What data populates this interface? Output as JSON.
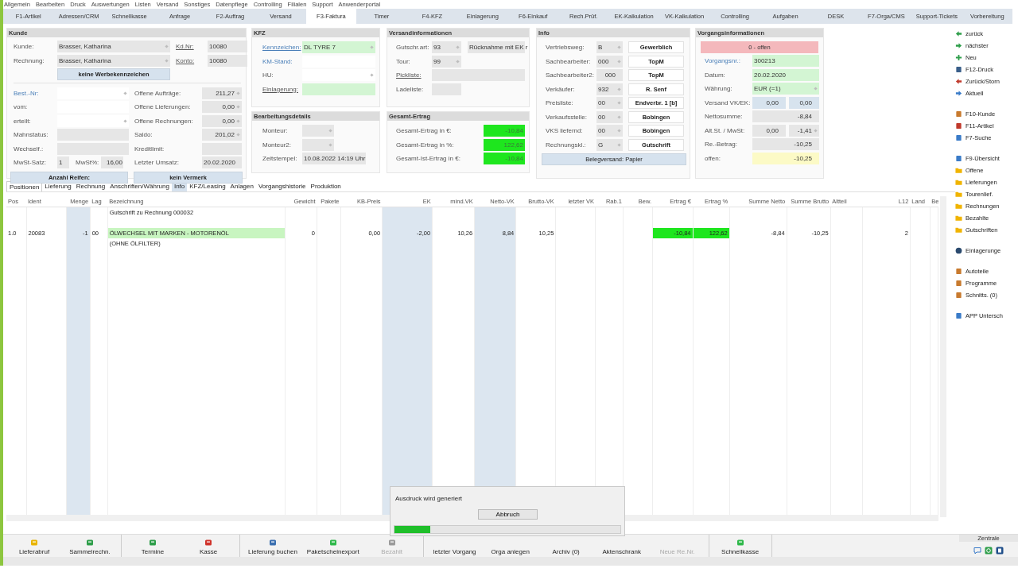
{
  "menu": [
    "Allgemein",
    "Bearbeiten",
    "Druck",
    "Auswertungen",
    "Listen",
    "Versand",
    "Sonstiges",
    "Datenpflege",
    "Controlling",
    "Filialen",
    "Support",
    "Anwenderportal"
  ],
  "tabs": [
    {
      "label": "F1-Artikel",
      "selected": false
    },
    {
      "label": "Adressen/CRM",
      "selected": false
    },
    {
      "label": "Schnellkasse",
      "selected": false
    },
    {
      "label": "Anfrage",
      "selected": false
    },
    {
      "label": "F2-Auftrag",
      "selected": false
    },
    {
      "label": "Versand",
      "selected": false
    },
    {
      "label": "F3-Faktura",
      "selected": true
    },
    {
      "label": "Timer",
      "selected": false
    },
    {
      "label": "F4-KFZ",
      "selected": false
    },
    {
      "label": "Einlagerung",
      "selected": false
    },
    {
      "label": "F6-Einkauf",
      "selected": false
    },
    {
      "label": "Rech.Prüf.",
      "selected": false
    },
    {
      "label": "EK-Kalkulation",
      "selected": false
    },
    {
      "label": "VK-Kalkulation",
      "selected": false
    },
    {
      "label": "Controlling",
      "selected": false
    },
    {
      "label": "Aufgaben",
      "selected": false
    },
    {
      "label": "DESK",
      "selected": false
    },
    {
      "label": "F7-Orga/CMS",
      "selected": false
    },
    {
      "label": "Support-Tickets",
      "selected": false
    },
    {
      "label": "Vorbereitung",
      "selected": false
    }
  ],
  "kunde": {
    "title": "Kunde",
    "top": [
      {
        "label": "Kunde:",
        "field": {
          "value": "Brasser, Katharina",
          "color": "#e6e6e6",
          "dropdown": true
        },
        "id_label": "Kd.Nr:",
        "id_field": {
          "value": "10080",
          "color": "#e6e6e6"
        }
      },
      {
        "label": "Rechnung:",
        "field": {
          "value": "Brasser, Katharina",
          "color": "#e6e6e6",
          "dropdown": true
        },
        "id_label": "Konto:",
        "id_field": {
          "value": "10080",
          "color": "#e6e6e6"
        }
      }
    ],
    "button": "keine Werbekennzeichen",
    "left": [
      {
        "label": "Best.-Nr:",
        "link": false,
        "accent": true,
        "fields": [
          {
            "color": "#ffffff",
            "dropdown": true
          }
        ]
      },
      {
        "label": "vom:",
        "link": false,
        "accent": false,
        "fields": [
          {
            "color": "#ffffff"
          }
        ]
      },
      {
        "label": "erteilt:",
        "link": false,
        "accent": false,
        "fields": [
          {
            "color": "#ffffff",
            "dropdown": true
          }
        ]
      },
      {
        "label": "Mahnstatus:",
        "link": false,
        "accent": false,
        "fields": [
          {
            "color": "#e6e6e6"
          }
        ]
      },
      {
        "label": "Wechself.:",
        "link": false,
        "accent": false,
        "fields": [
          {
            "color": "#e6e6e6"
          }
        ]
      }
    ],
    "mwst": {
      "label": "MwSt-Satz:",
      "field": {
        "value": "1",
        "color": "#e6e6e6"
      },
      "label2": "MwSt%:",
      "field2": {
        "value": "16,00",
        "color": "#e6e6e6"
      }
    },
    "right": [
      {
        "label": "Offene Aufträge:",
        "link": false,
        "accent": false,
        "fields": [
          {
            "value": "211,27",
            "color": "#e6e6e6",
            "dropdown": true
          }
        ]
      },
      {
        "label": "Offene Lieferungen:",
        "link": false,
        "accent": false,
        "fields": [
          {
            "value": "0,00",
            "color": "#e6e6e6",
            "dropdown": true
          }
        ]
      },
      {
        "label": "Offene Rechnungen:",
        "link": false,
        "accent": false,
        "fields": [
          {
            "value": "0,00",
            "color": "#e6e6e6",
            "dropdown": true
          }
        ]
      },
      {
        "label": "Saldo:",
        "link": false,
        "accent": false,
        "fields": [
          {
            "value": "201,02",
            "color": "#e6e6e6",
            "dropdown": true
          }
        ]
      },
      {
        "label": "Kreditlimit:",
        "link": false,
        "accent": false,
        "fields": [
          {
            "color": "#e6e6e6"
          }
        ]
      },
      {
        "label": "Letzter Umsatz:",
        "link": false,
        "accent": false,
        "fields": [
          {
            "value": "20.02.2020",
            "color": "#e6e6e6"
          }
        ]
      }
    ],
    "buttons": [
      "Anzahl Reifen:",
      "kein Vermerk"
    ]
  },
  "kfz": {
    "title": "KFZ",
    "rows": [
      {
        "label": "Kennzeichen:",
        "link": true,
        "accent": true,
        "fields": [
          {
            "value": "DL TYRE 7",
            "color": "#d3f5d3",
            "dropdown": true
          }
        ]
      },
      {
        "label": "KM-Stand:",
        "link": false,
        "accent": true,
        "fields": [
          {
            "color": "#ffffff"
          }
        ]
      },
      {
        "label": "HU:",
        "link": false,
        "accent": false,
        "fields": [
          {
            "color": "#ffffff",
            "dropdown": true
          }
        ]
      },
      {
        "label": "Einlagerung:",
        "link": true,
        "accent": false,
        "fields": [
          {
            "color": "#d3f5d3"
          }
        ]
      }
    ]
  },
  "bearbeitung": {
    "title": "Bearbeitungsdetails",
    "rows": [
      {
        "label": "Monteur:",
        "link": false,
        "accent": false,
        "fields": [
          {
            "color": "#e6e6e6",
            "dropdown": true
          }
        ]
      },
      {
        "label": "Monteur2:",
        "link": false,
        "accent": false,
        "fields": [
          {
            "color": "#e6e6e6",
            "dropdown": true
          }
        ]
      },
      {
        "label": "Zeitstempel:",
        "link": false,
        "accent": false,
        "fields": [
          {
            "value": "10.08.2022 14:19 Uhr",
            "color": "#e6e6e6"
          }
        ]
      }
    ]
  },
  "versand": {
    "title": "Versandinformationen",
    "rows": [
      {
        "label": "Gutschr.art:",
        "link": false,
        "accent": false,
        "fields": [
          {
            "value": "93",
            "color": "#e6e6e6",
            "dropdown": true
          },
          {
            "value": "Rücknahme mit EK r",
            "color": "#e6e6e6"
          }
        ]
      },
      {
        "label": "Tour:",
        "link": false,
        "accent": false,
        "fields": [
          {
            "value": "99",
            "color": "#e6e6e6",
            "dropdown": true
          }
        ]
      },
      {
        "label": "Pickliste:",
        "link": true,
        "accent": false,
        "fields": [
          {
            "color": "#e6e6e6"
          }
        ]
      },
      {
        "label": "Ladeliste:",
        "link": false,
        "accent": false,
        "fields": [
          {
            "color": "#e6e6e6"
          }
        ]
      }
    ]
  },
  "ertrag": {
    "title": "Gesamt-Ertrag",
    "rows": [
      {
        "label": "Gesamt-Ertrag in €:",
        "link": false,
        "accent": false,
        "fields": [
          {
            "value": "-10,84",
            "color": "#1ee61e"
          }
        ]
      },
      {
        "label": "Gesamt-Ertrag in %:",
        "link": false,
        "accent": false,
        "fields": [
          {
            "value": "122,62",
            "color": "#1ee61e"
          }
        ]
      },
      {
        "label": "Gesamt-Ist-Ertrag in €:",
        "link": false,
        "accent": false,
        "fields": [
          {
            "value": "-10,84",
            "color": "#1ee61e"
          }
        ]
      }
    ]
  },
  "info": {
    "title": "Info",
    "rows": [
      {
        "label": "Vertriebsweg:",
        "code": {
          "value": "B",
          "color": "#e6e6e6",
          "dropdown": true
        },
        "button": "Gewerblich"
      },
      {
        "label": "Sachbearbeiter:",
        "code": {
          "value": "000",
          "color": "#e6e6e6",
          "dropdown": true
        },
        "button": "TopM"
      },
      {
        "label": "Sachbearbeiter2:",
        "code": {
          "value": "000",
          "color": "#e6e6e6"
        },
        "button": "TopM"
      },
      {
        "label": "Verkäufer:",
        "code": {
          "value": "932",
          "color": "#e6e6e6",
          "dropdown": true
        },
        "button": "R. Senf"
      },
      {
        "label": "Preisliste:",
        "code": {
          "value": "00",
          "color": "#e6e6e6",
          "dropdown": true
        },
        "button": "Endverbr. 1 [b]"
      },
      {
        "label": "Verkaufsstelle:",
        "code": {
          "value": "00",
          "color": "#e6e6e6",
          "dropdown": true
        },
        "button": "Bobingen"
      },
      {
        "label": "VKS liefernd:",
        "code": {
          "value": "00",
          "color": "#e6e6e6",
          "dropdown": true
        },
        "button": "Bobingen"
      },
      {
        "label": "Rechnungskl.:",
        "code": {
          "value": "G",
          "color": "#e6e6e6",
          "dropdown": true
        },
        "button": "Gutschrift"
      }
    ],
    "footer_button": "Belegversand: Papier"
  },
  "vorgang": {
    "title": "Vorgangsinformationen",
    "status": "0 - offen",
    "rows": [
      {
        "label": "Vorgangsnr.:",
        "link": false,
        "accent": true,
        "fields": [
          {
            "value": "300213",
            "color": "#d3f5d3"
          }
        ]
      },
      {
        "label": "Datum:",
        "link": false,
        "accent": false,
        "fields": [
          {
            "value": "20.02.2020",
            "color": "#d3f5d3"
          }
        ]
      },
      {
        "label": "Währung:",
        "link": false,
        "accent": false,
        "fields": [
          {
            "value": "EUR (=1)",
            "color": "#d3f5d3",
            "dropdown": true
          }
        ]
      },
      {
        "label": "Versand VK/EK:",
        "link": false,
        "accent": false,
        "fields": [
          {
            "value": "0,00",
            "color": "#d7e3ee"
          },
          {
            "value": "0,00",
            "color": "#d7e3ee"
          }
        ]
      },
      {
        "label": "Nettosumme:",
        "link": false,
        "accent": false,
        "fields": [
          {
            "value": "-8,84",
            "color": "#e6e6e6"
          }
        ]
      },
      {
        "label": "Alt.St. / MwSt:",
        "link": false,
        "accent": false,
        "fields": [
          {
            "value": "0,00",
            "color": "#e6e6e6"
          },
          {
            "value": "-1,41",
            "color": "#e6e6e6",
            "dropdown": true
          }
        ]
      },
      {
        "label": "Re.-Betrag:",
        "link": false,
        "accent": false,
        "fields": [
          {
            "value": "-10,25",
            "color": "#e6e6e6"
          }
        ]
      },
      {
        "label": "offen:",
        "link": false,
        "accent": false,
        "fields": [
          {
            "value": "-10,25",
            "color": "#fcfac6"
          }
        ]
      }
    ]
  },
  "subtabs": [
    {
      "label": "Positionen",
      "selected": true,
      "highlighted": false
    },
    {
      "label": "Lieferung",
      "selected": false,
      "highlighted": false
    },
    {
      "label": "Rechnung",
      "selected": false,
      "highlighted": false
    },
    {
      "label": "Anschriften/Währung",
      "selected": false,
      "highlighted": false
    },
    {
      "label": "Info",
      "selected": false,
      "highlighted": true
    },
    {
      "label": "KFZ/Leasing",
      "selected": false,
      "highlighted": false
    },
    {
      "label": "Anlagen",
      "selected": false,
      "highlighted": false
    },
    {
      "label": "Vorgangshistorie",
      "selected": false,
      "highlighted": false
    },
    {
      "label": "Produktion",
      "selected": false,
      "highlighted": false
    }
  ],
  "table": {
    "columns": [
      {
        "label": "Pos",
        "shaded": false
      },
      {
        "label": "Ident",
        "shaded": false
      },
      {
        "label": "Menge",
        "shaded": true
      },
      {
        "label": "Lag",
        "shaded": false
      },
      {
        "label": "Bezeichnung",
        "shaded": false
      },
      {
        "label": "Gewicht",
        "shaded": false
      },
      {
        "label": "Pakete",
        "shaded": false
      },
      {
        "label": "KB-Preis",
        "shaded": false
      },
      {
        "label": "EK",
        "shaded": true
      },
      {
        "label": "mind.VK",
        "shaded": false
      },
      {
        "label": "Netto-VK",
        "shaded": true
      },
      {
        "label": "Brutto-VK",
        "shaded": false
      },
      {
        "label": "letzter VK",
        "shaded": false
      },
      {
        "label": "Rab.1",
        "shaded": false
      },
      {
        "label": "Bew.",
        "shaded": false
      },
      {
        "label": "Ertrag €",
        "shaded": false
      },
      {
        "label": "Ertrag %",
        "shaded": false
      },
      {
        "label": "Summe Netto",
        "shaded": false
      },
      {
        "label": "Summe Brutto",
        "shaded": false
      },
      {
        "label": "Altteil",
        "shaded": false
      },
      {
        "label": "L12",
        "shaded": false
      },
      {
        "label": "Land",
        "shaded": false
      },
      {
        "label": "Be",
        "shaded": false
      }
    ],
    "rows": [
      {
        "kind": "note",
        "cells": [
          {
            "highlighted": false
          },
          {
            "highlighted": false
          },
          {
            "highlighted": false
          },
          {
            "highlighted": false
          },
          {
            "text": "Gutschrift zu Rechnung 000032",
            "highlighted": false
          },
          {
            "highlighted": false
          },
          {
            "highlighted": false
          },
          {
            "highlighted": false
          },
          {
            "highlighted": false
          },
          {
            "highlighted": false
          },
          {
            "highlighted": false
          },
          {
            "highlighted": false
          },
          {
            "highlighted": false
          },
          {
            "highlighted": false
          },
          {
            "highlighted": false
          },
          {
            "highlighted": false
          },
          {
            "highlighted": false
          },
          {
            "highlighted": false
          },
          {
            "highlighted": false
          },
          {
            "highlighted": false
          },
          {
            "highlighted": false
          },
          {
            "highlighted": false
          },
          {
            "highlighted": false
          }
        ]
      },
      {
        "kind": "item",
        "cells": [
          {
            "text": "1.0",
            "highlighted": false
          },
          {
            "text": "20083",
            "highlighted": false
          },
          {
            "text": "-1",
            "highlighted": false
          },
          {
            "text": "00",
            "highlighted": false
          },
          {
            "text": "ÖLWECHSEL MIT MARKEN - MOTORENÖL",
            "highlighted": true
          },
          {
            "text": "0",
            "highlighted": false
          },
          {
            "highlighted": false
          },
          {
            "text": "0,00",
            "highlighted": false
          },
          {
            "text": "-2,00",
            "highlighted": false
          },
          {
            "text": "10,26",
            "highlighted": false
          },
          {
            "text": "8,84",
            "highlighted": false
          },
          {
            "text": "10,25",
            "highlighted": false
          },
          {
            "highlighted": false
          },
          {
            "highlighted": false
          },
          {
            "highlighted": false
          },
          {
            "text": "-10,84",
            "highlighted": true
          },
          {
            "text": "122,62",
            "highlighted": true
          },
          {
            "text": "-8,84",
            "highlighted": false
          },
          {
            "text": "-10,25",
            "highlighted": false
          },
          {
            "highlighted": false
          },
          {
            "text": "2",
            "highlighted": false
          },
          {
            "highlighted": false
          },
          {
            "highlighted": false
          }
        ]
      },
      {
        "kind": "item",
        "cells": [
          {
            "highlighted": false
          },
          {
            "highlighted": false
          },
          {
            "highlighted": false
          },
          {
            "highlighted": false
          },
          {
            "text": "(OHNE ÖLFILTER)",
            "highlighted": false
          },
          {
            "highlighted": false
          },
          {
            "highlighted": false
          },
          {
            "highlighted": false
          },
          {
            "highlighted": false
          },
          {
            "highlighted": false
          },
          {
            "highlighted": false
          },
          {
            "highlighted": false
          },
          {
            "highlighted": false
          },
          {
            "highlighted": false
          },
          {
            "highlighted": false
          },
          {
            "highlighted": false
          },
          {
            "highlighted": false
          },
          {
            "highlighted": false
          },
          {
            "highlighted": false
          },
          {
            "highlighted": false
          },
          {
            "highlighted": false
          },
          {
            "highlighted": false
          },
          {
            "highlighted": false
          }
        ]
      }
    ]
  },
  "sidebar": {
    "groups": [
      {
        "items": [
          {
            "label": "zurück",
            "kind": "back",
            "color": "#2e9e4a"
          },
          {
            "label": "nächster",
            "kind": "forward",
            "color": "#2e9e4a"
          },
          {
            "label": "Neu",
            "kind": "plus",
            "color": "#2e9e4a"
          },
          {
            "label": "F12-Druck",
            "kind": "page",
            "color": "#3a5f8a"
          },
          {
            "label": "Zurück/Storn",
            "kind": "back",
            "color": "#c0392b"
          },
          {
            "label": "Aktuell",
            "kind": "forward",
            "color": "#3a7bc8"
          }
        ]
      },
      {
        "items": [
          {
            "label": "F10-Kunde",
            "kind": "page",
            "color": "#c87a2e"
          },
          {
            "label": "F11-Artikel",
            "kind": "page",
            "color": "#c0392b"
          },
          {
            "label": "F7-Suche",
            "kind": "page",
            "color": "#3a7bc8"
          }
        ]
      },
      {
        "items": [
          {
            "label": "F9-Übersicht",
            "kind": "page",
            "color": "#3a7bc8"
          },
          {
            "label": "Offene",
            "kind": "folder",
            "color": "#f0b400"
          },
          {
            "label": "Lieferungen",
            "kind": "folder",
            "color": "#f0b400"
          },
          {
            "label": "Tourenlief.",
            "kind": "folder",
            "color": "#f0b400"
          },
          {
            "label": "Rechnungen",
            "kind": "folder",
            "color": "#f0b400"
          },
          {
            "label": "Bezahlte",
            "kind": "folder",
            "color": "#f0b400"
          },
          {
            "label": "Gutschriften",
            "kind": "folder",
            "color": "#f0b400"
          }
        ]
      },
      {
        "items": [
          {
            "label": "Einlagerunge",
            "kind": "dot",
            "color": "#2b4a6e"
          }
        ]
      },
      {
        "items": [
          {
            "label": "Autoteile",
            "kind": "page",
            "color": "#c87a2e"
          },
          {
            "label": "Programme",
            "kind": "page",
            "color": "#c87a2e"
          },
          {
            "label": "Schnitts. (0)",
            "kind": "page",
            "color": "#c87a2e"
          }
        ]
      },
      {
        "items": [
          {
            "label": "APP Untersch",
            "kind": "page",
            "color": "#3a7bc8"
          }
        ]
      }
    ]
  },
  "toolbar": {
    "groups": [
      {
        "items": [
          {
            "label": "Lieferabruf",
            "color": "#e8b400",
            "disabled": false
          },
          {
            "label": "Sammelrechn.",
            "color": "#2e9e4a",
            "disabled": false
          }
        ]
      },
      {
        "items": [
          {
            "label": "Termine",
            "color": "#2e9e4a",
            "disabled": false
          },
          {
            "label": "Kasse",
            "color": "#d0342c",
            "disabled": false
          }
        ]
      },
      {
        "items": [
          {
            "label": "Lieferung buchen",
            "color": "#3a6fb0",
            "disabled": false
          },
          {
            "label": "Paketscheinexport",
            "color": "#2eb84a",
            "disabled": false
          },
          {
            "label": "Bezahlt",
            "color": "#9a9a9a",
            "disabled": true
          }
        ]
      },
      {
        "items": [
          {
            "label": "letzter Vorgang",
            "disabled": false
          },
          {
            "label": "Orga anlegen",
            "disabled": false
          },
          {
            "label": "Archiv (0)",
            "disabled": false
          },
          {
            "label": "Aktenschrank",
            "disabled": false
          },
          {
            "label": "Neue Re.Nr.",
            "disabled": true
          }
        ]
      },
      {
        "items": [
          {
            "label": "Schnellkasse",
            "color": "#2eb84a",
            "disabled": false
          }
        ]
      }
    ],
    "location": "Zentrale"
  },
  "dialog": {
    "title": "Ausdruck wird generiert",
    "button": "Abbruch",
    "progress": {
      "level": 0.16
    }
  }
}
